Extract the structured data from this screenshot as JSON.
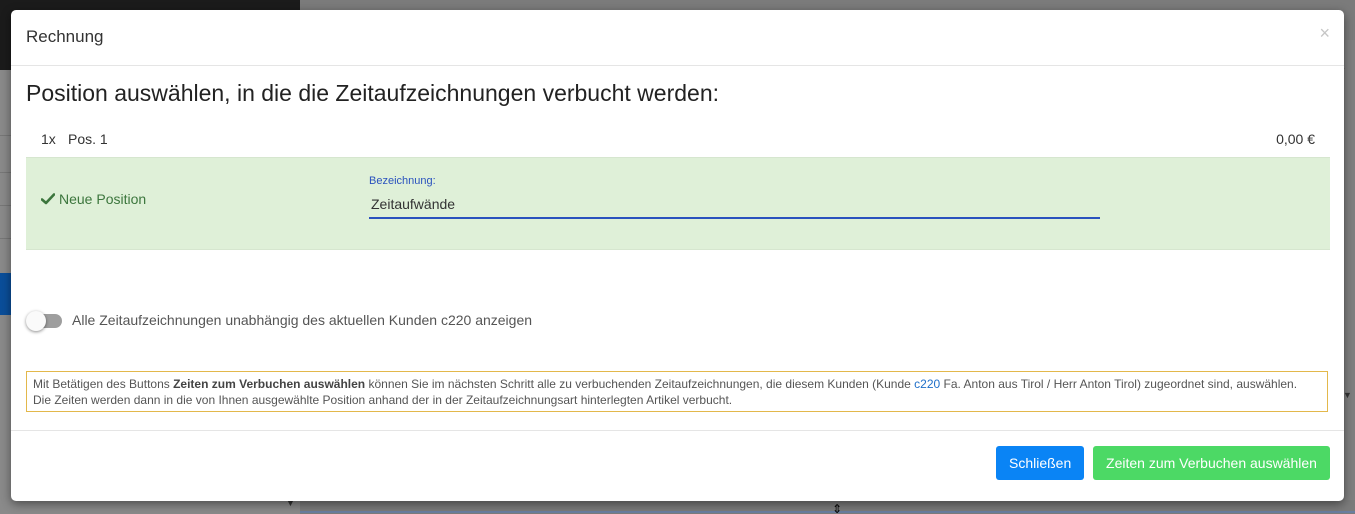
{
  "modal": {
    "title": "Rechnung",
    "close_symbol": "×",
    "heading": "Position auswählen, in die die Zeitaufzeichnungen verbucht werden:"
  },
  "position": {
    "quantity": "1x",
    "name": "Pos. 1",
    "amount": "0,00 €"
  },
  "new_position": {
    "label": "Neue Position",
    "icon": "check-icon",
    "field_label": "Bezeichnung:",
    "field_value": "Zeitaufwände"
  },
  "toggle": {
    "label": "Alle Zeitaufzeichnungen unabhängig des aktuellen Kunden c220 anzeigen",
    "checked": false
  },
  "info": {
    "line1_before": "Mit Betätigen des Buttons ",
    "line1_bold": "Zeiten zum Verbuchen auswählen",
    "line1_mid": " können Sie im nächsten Schritt alle zu verbuchenden Zeitaufzeichnungen, die diesem Kunden (Kunde ",
    "line1_link": "c220",
    "line1_after": " Fa. Anton aus Tirol / Herr Anton Tirol) zugeordnet sind, auswählen.",
    "line2": "Die Zeiten werden dann in die von Ihnen ausgewählte Position anhand der in der Zeitaufzeichnungsart hinterlegten Artikel verbucht."
  },
  "footer": {
    "close_label": "Schließen",
    "select_label": "Zeiten zum Verbuchen auswählen"
  },
  "colors": {
    "success_bg": "#dff0d8",
    "success_text": "#3c763d",
    "primary": "#0a84f5",
    "success_button": "#4cd965",
    "warning_border": "#e3b84b",
    "input_accent": "#2a52be"
  }
}
